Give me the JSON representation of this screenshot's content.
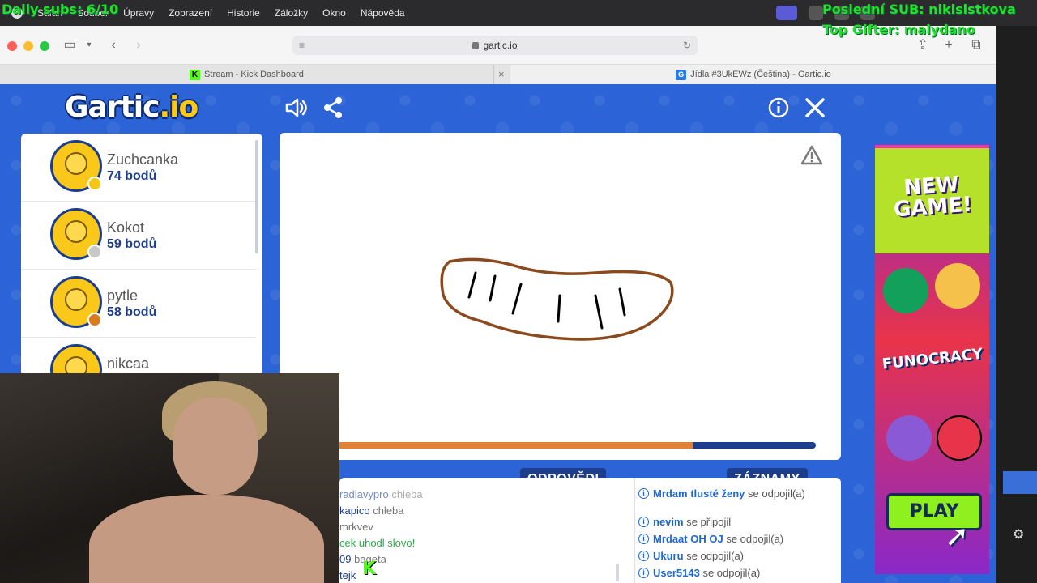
{
  "menubar": {
    "items": [
      "Safari",
      "Soubor",
      "Úpravy",
      "Zobrazení",
      "Historie",
      "Záložky",
      "Okno",
      "Nápověda"
    ]
  },
  "overlay": {
    "daily_subs": "Daily subs: 6/10",
    "last_sub": "Poslední SUB: nikisistkova",
    "top_gifter": "Top Gifter: malydano"
  },
  "browser": {
    "url": "gartic.io",
    "tabs": [
      {
        "label": "Stream - Kick Dashboard",
        "icon": "kick-icon"
      },
      {
        "label": "Jídla #3UkEWz (Čeština) - Gartic.io",
        "icon": "gartic-icon"
      }
    ]
  },
  "game": {
    "logo_main": "Gartic",
    "logo_suffix": ".io",
    "players": [
      {
        "name": "Zuchcanka",
        "score": "74 bodů",
        "medal_color": "#f5c518"
      },
      {
        "name": "Kokot",
        "score": "59 bodů",
        "medal_color": "#c8c8c8"
      },
      {
        "name": "pytle",
        "score": "58 bodů",
        "medal_color": "#d97a1e"
      },
      {
        "name": "nikcaa",
        "score": "",
        "medal_color": ""
      }
    ],
    "progress": 0.77,
    "answers_label": "ODPOVĚDI",
    "records_label": "ZÁZNAMY",
    "answers": [
      {
        "user": "radiavypro",
        "text": "chleba"
      },
      {
        "user": "kapico",
        "text": "chleba"
      },
      {
        "user": "",
        "text": "mrkvev"
      },
      {
        "user": "cek",
        "text": "uhodl slovo!",
        "correct": true
      },
      {
        "user": "09",
        "text": "bageta"
      },
      {
        "user": "tejk",
        "text": ""
      }
    ],
    "records": [
      {
        "user": "Mrdam tlusté ženy",
        "text": "se odpojil(a)"
      },
      {
        "user": "nevim",
        "text": "se připojil"
      },
      {
        "user": "Mrdaat OH OJ",
        "text": "se odpojil(a)"
      },
      {
        "user": "Ukuru",
        "text": "se odpojil(a)"
      },
      {
        "user": "User5143",
        "text": "se odpojil(a)"
      }
    ]
  },
  "ad": {
    "new_game": "NEW GAME!",
    "funocracy": "FUNOCRACY",
    "play": "PLAY"
  },
  "colors": {
    "game_bg": "#2c63d6",
    "navy": "#1c3d8c",
    "overlay_green": "#22e02c",
    "kick_green": "#53fc18"
  }
}
